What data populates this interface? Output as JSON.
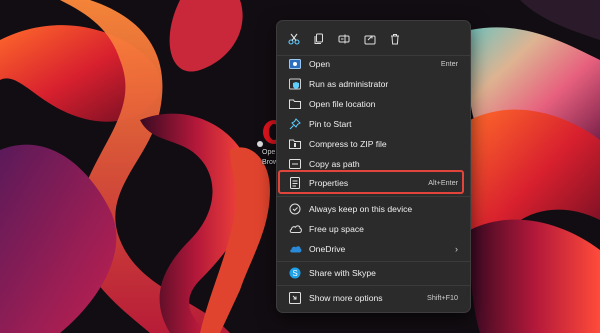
{
  "desktop": {
    "icon_label_line1": "Ope",
    "icon_label_line2": "Brows"
  },
  "context_menu": {
    "quick_actions": [
      {
        "name": "cut-icon",
        "tooltip": "Cut"
      },
      {
        "name": "copy-icon",
        "tooltip": "Copy"
      },
      {
        "name": "rename-icon",
        "tooltip": "Rename"
      },
      {
        "name": "share-icon",
        "tooltip": "Share"
      },
      {
        "name": "delete-icon",
        "tooltip": "Delete"
      }
    ],
    "items": [
      {
        "label": "Open",
        "shortcut": "Enter",
        "icon": "app-icon"
      },
      {
        "label": "Run as administrator",
        "shortcut": "",
        "icon": "shield-icon"
      },
      {
        "label": "Open file location",
        "shortcut": "",
        "icon": "folder-icon"
      },
      {
        "label": "Pin to Start",
        "shortcut": "",
        "icon": "pin-icon"
      },
      {
        "label": "Compress to ZIP file",
        "shortcut": "",
        "icon": "zip-icon"
      },
      {
        "label": "Copy as path",
        "shortcut": "",
        "icon": "path-icon"
      },
      {
        "label": "Properties",
        "shortcut": "Alt+Enter",
        "icon": "properties-icon"
      },
      {
        "label": "Always keep on this device",
        "shortcut": "",
        "icon": "cloud-pin-icon"
      },
      {
        "label": "Free up space",
        "shortcut": "",
        "icon": "cloud-icon"
      },
      {
        "label": "OneDrive",
        "shortcut": "",
        "icon": "onedrive-icon",
        "has_submenu": true
      },
      {
        "label": "Share with Skype",
        "shortcut": "",
        "icon": "skype-icon"
      },
      {
        "label": "Show more options",
        "shortcut": "Shift+F10",
        "icon": "more-options-icon"
      }
    ]
  },
  "colors": {
    "menu_bg": "#2b2b2b",
    "highlight": "#e0443a",
    "icon_accent": "#60cdff"
  }
}
